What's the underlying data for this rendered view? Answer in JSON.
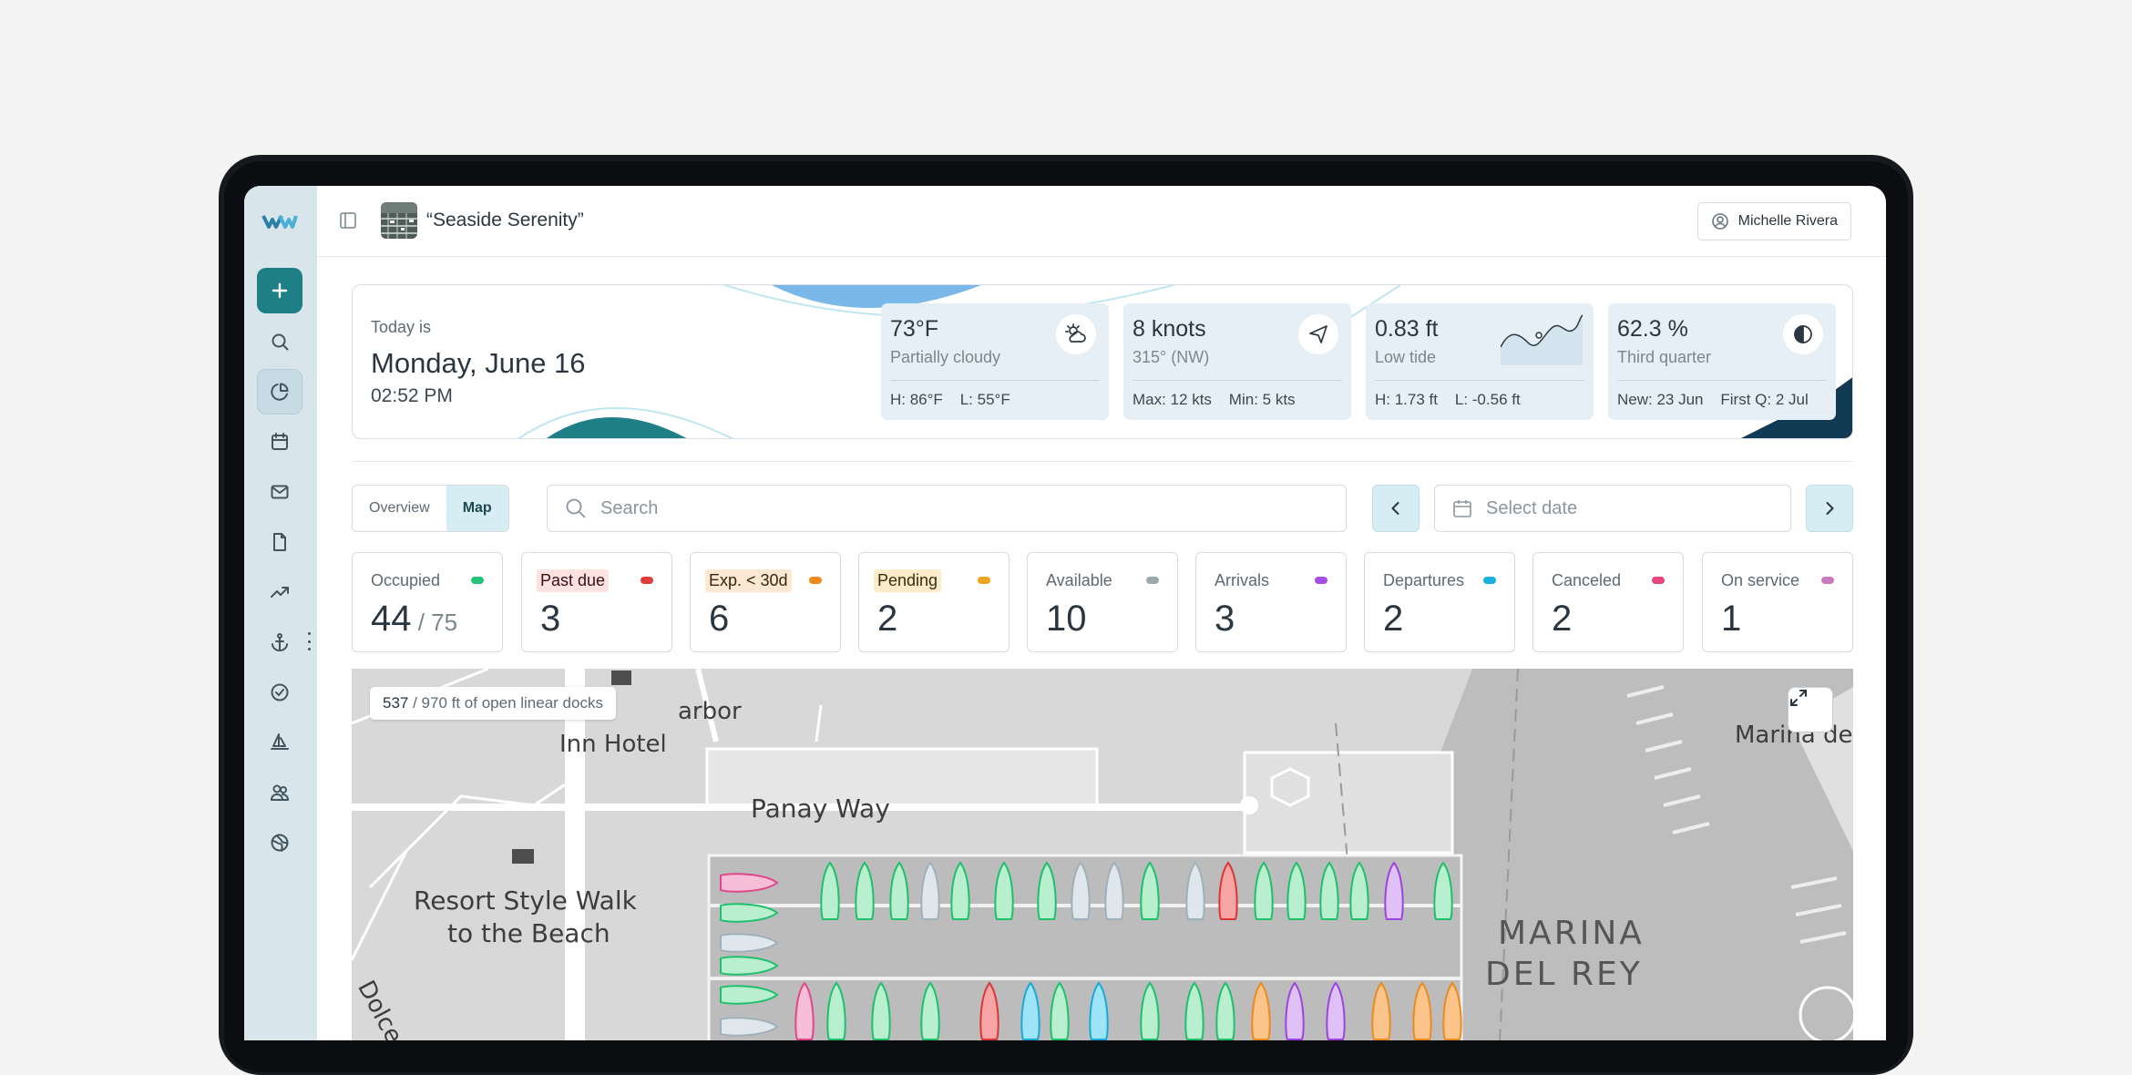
{
  "topbar": {
    "property_name": "“Seaside Serenity”",
    "user_name": "Michelle Rivera"
  },
  "rail": {
    "icons": [
      "logo",
      "plus-icon",
      "search-icon",
      "pie-chart-icon",
      "calendar-icon",
      "mail-icon",
      "file-icon",
      "trending-up-icon",
      "anchor-icon",
      "check-circle-icon",
      "sailboat-icon",
      "users-icon",
      "globe-icon"
    ],
    "active": "pie-chart-icon"
  },
  "hero": {
    "today_label": "Today is",
    "date": "Monday, June 16",
    "time": "02:52 PM",
    "weather": {
      "value": "73°F",
      "desc": "Partially cloudy",
      "foot": "H: 86°F    L: 55°F"
    },
    "wind": {
      "value": "8 knots",
      "desc": "315° (NW)",
      "foot": "Max: 12 kts    Min: 5 kts"
    },
    "tide": {
      "value": "0.83 ft",
      "desc": "Low tide",
      "foot": "H: 1.73 ft    L: -0.56 ft"
    },
    "moon": {
      "value": "62.3 %",
      "desc": "Third quarter",
      "foot": "New: 23 Jun    First Q: 2 Jul"
    }
  },
  "view_toggle": {
    "overview": "Overview",
    "map": "Map",
    "selected": "Map"
  },
  "search": {
    "placeholder": "Search",
    "value": ""
  },
  "date_picker": {
    "placeholder": "Select date"
  },
  "stats": [
    {
      "label": "Occupied",
      "value": "44",
      "total": " / 75",
      "color": "#22c47a",
      "tag_bg": ""
    },
    {
      "label": "Past due",
      "value": "3",
      "color": "#e23b3b",
      "tag_bg": "#fde2e2"
    },
    {
      "label": "Exp. < 30d",
      "value": "6",
      "color": "#f08a1c",
      "tag_bg": "#fde8d4"
    },
    {
      "label": "Pending",
      "value": "2",
      "color": "#f0a41c",
      "tag_bg": "#fcecc9"
    },
    {
      "label": "Available",
      "value": "10",
      "color": "#9aa8b0",
      "tag_bg": ""
    },
    {
      "label": "Arrivals",
      "value": "3",
      "color": "#a64dea",
      "tag_bg": ""
    },
    {
      "label": "Departures",
      "value": "2",
      "color": "#1ab0e0",
      "tag_bg": ""
    },
    {
      "label": "Canceled",
      "value": "2",
      "color": "#e8457f",
      "tag_bg": ""
    },
    {
      "label": "On service",
      "value": "1",
      "color": "#c77ac0",
      "tag_bg": ""
    }
  ],
  "map": {
    "open_docks_value": "537",
    "open_docks_text": " / 970 ft of open linear docks",
    "labels": {
      "harbor": "arbor",
      "inn_hotel": "Inn Hotel",
      "panay_way": "Panay Way",
      "resort_1": "Resort Style Walk",
      "resort_2": "to the Beach",
      "marina_1": "MARINA",
      "marina_2": "DEL REY",
      "marina_de": "Marina de",
      "dolce": "Dolce"
    },
    "slip_status_top_row": [
      "occupied",
      "occupied",
      "occupied",
      "available",
      "occupied",
      "occupied",
      "occupied",
      "available",
      "available",
      "occupied",
      "available",
      "past_due",
      "occupied",
      "occupied",
      "occupied",
      "occupied",
      "arrival",
      "occupied"
    ],
    "slip_status_bottom_row": [
      "canceled",
      "occupied",
      "occupied",
      "occupied",
      "past_due",
      "departure",
      "occupied",
      "departure",
      "occupied",
      "occupied",
      "occupied",
      "expiring",
      "arrival",
      "arrival",
      "expiring",
      "expiring",
      "expiring"
    ],
    "slip_status_left_column": [
      "canceled",
      "occupied",
      "available",
      "occupied",
      "occupied",
      "available"
    ]
  }
}
